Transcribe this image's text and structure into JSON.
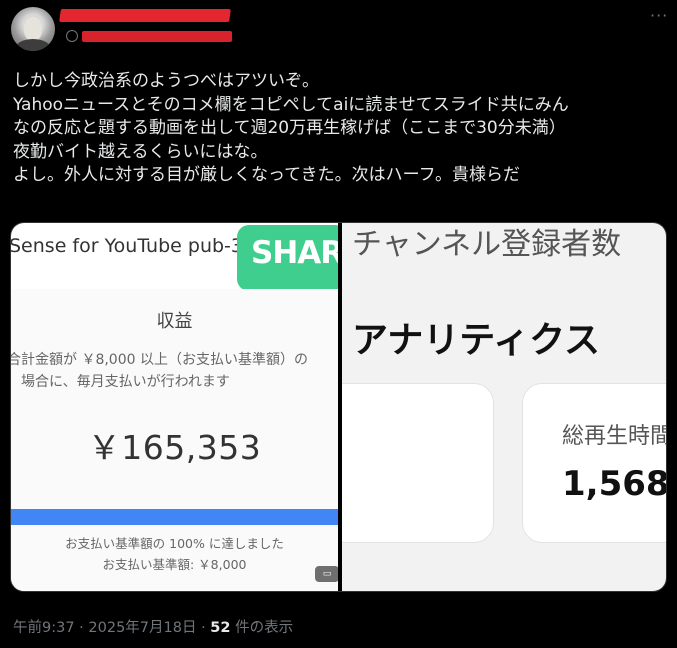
{
  "author": {
    "avatar_icon": "person-avatar",
    "name_redacted": true,
    "handle_prefix": "@",
    "handle_redacted": true
  },
  "menu": {
    "more_icon": "more-icon",
    "label": "···"
  },
  "tweet": {
    "lines": [
      "しかし今政治系のようつべはアツいぞ。",
      "Yahooニュースとそのコメ欄をコピペしてaiに読ませてスライド共にみん",
      "なの反応と題する動画を出して週20万再生稼げば（ここまで30分未満）",
      "夜勤バイト越えるくらいにはな。",
      "よし。外人に対する目が厳しくなってきた。次はハーフ。貴様らだ"
    ]
  },
  "media": {
    "left": {
      "header": "Sense for YouTube pub-3",
      "share_badge": "SHAR",
      "revenue_label": "収益",
      "note_lines": [
        "合計金額が ￥8,000 以上（お支払い基準額）の",
        "場合に、毎月支払いが行われます"
      ],
      "amount": "￥165,353",
      "progress_percent": 100,
      "payout_reached": "お支払い基準額の 100% に達しました",
      "payout_threshold": "お支払い基準額: ￥8,000",
      "alt_badge_icon": "comment-icon"
    },
    "right": {
      "channel_subs": "チャンネル登録者数",
      "analytics_title": "アナリティクス",
      "watch_time_label": "総再生時間",
      "watch_time_value": "1,568"
    }
  },
  "meta": {
    "time": "午前9:37",
    "sep1": "·",
    "date": "2025年7月18日",
    "sep2": "·",
    "views": "52",
    "views_suffix": "件の表示"
  },
  "colors": {
    "background": "#000000",
    "text": "#e7e9ea",
    "muted": "#71767b",
    "redaction": "#e3262f",
    "share_green": "#3fce8e",
    "progress_blue": "#4285f4"
  }
}
